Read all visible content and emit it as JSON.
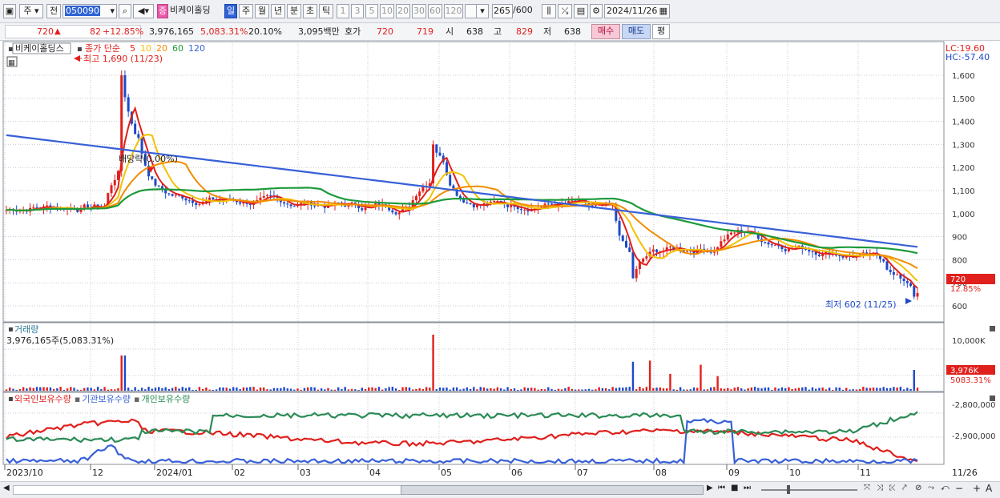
{
  "toolbar": {
    "period": "주",
    "prev": "전",
    "code": "050090",
    "name": "비케이홀딩",
    "name_badge": "증",
    "intervals": [
      "일",
      "주",
      "월",
      "년",
      "분",
      "초",
      "틱"
    ],
    "active_interval": "일",
    "minute_steps": [
      "1",
      "3",
      "5",
      "10",
      "20",
      "30",
      "60",
      "120"
    ],
    "count": "265",
    "count_max": "/600",
    "date": "2024/11/26"
  },
  "quote": {
    "price": "720",
    "change": "82",
    "change_pct": "+12.85%",
    "volume": "3,976,165",
    "volume_pct": "5,083.31%",
    "turnover_pct": "20.10%",
    "amount": "3,095백만",
    "hoga_label": "호가",
    "ask": "720",
    "bid": "719",
    "open_label": "시",
    "open": "638",
    "high_label": "고",
    "high": "829",
    "low_label": "저",
    "low": "638",
    "buy_label": "매수",
    "sell_label": "매도",
    "avg_label": "평"
  },
  "price_panel": {
    "stock_label": "비케이홀딩스",
    "legend_prefix": "종가 단순",
    "ma_labels": [
      {
        "label": "5",
        "color": "#e0201c"
      },
      {
        "label": "10",
        "color": "#f2c200"
      },
      {
        "label": "20",
        "color": "#f28c00"
      },
      {
        "label": "60",
        "color": "#1c9a3a"
      },
      {
        "label": "120",
        "color": "#3860d8"
      }
    ],
    "high_note": "최고 1,690 (11/23)",
    "low_note": "최저 602 (11/25)",
    "dividend_note": "배당락(0.00%)",
    "lc_label": "LC:19.60",
    "hc_label": "HC:-57.40",
    "current_price": "720",
    "current_pct": "12.85%",
    "y_ticks": [
      "1,600",
      "1,500",
      "1,400",
      "1,300",
      "1,200",
      "1,100",
      "1,000",
      "900",
      "800",
      "700",
      "600"
    ]
  },
  "volume_panel": {
    "title": "거래량",
    "info": "3,976,165주(5,083.31%)",
    "y_tick": "10,000K",
    "current": "3,976K",
    "current_pct": "5083.31%"
  },
  "holding_panel": {
    "series": [
      {
        "name": "외국인보유수량",
        "color": "#e0201c"
      },
      {
        "name": "기관보유수량",
        "color": "#3860d8"
      },
      {
        "name": "개인보유수량",
        "color": "#2a8a55"
      }
    ],
    "y_ticks": [
      "-2,800,000",
      "-2,900,000"
    ]
  },
  "x_axis": [
    "2023/10",
    "12",
    "2024/01",
    "02",
    "03",
    "04",
    "05",
    "06",
    "07",
    "08",
    "09",
    "10",
    "11"
  ],
  "x_end_label": "11/26",
  "colors": {
    "up": "#e0201c",
    "down": "#1e49c8",
    "grid": "#c7cbd2"
  }
}
